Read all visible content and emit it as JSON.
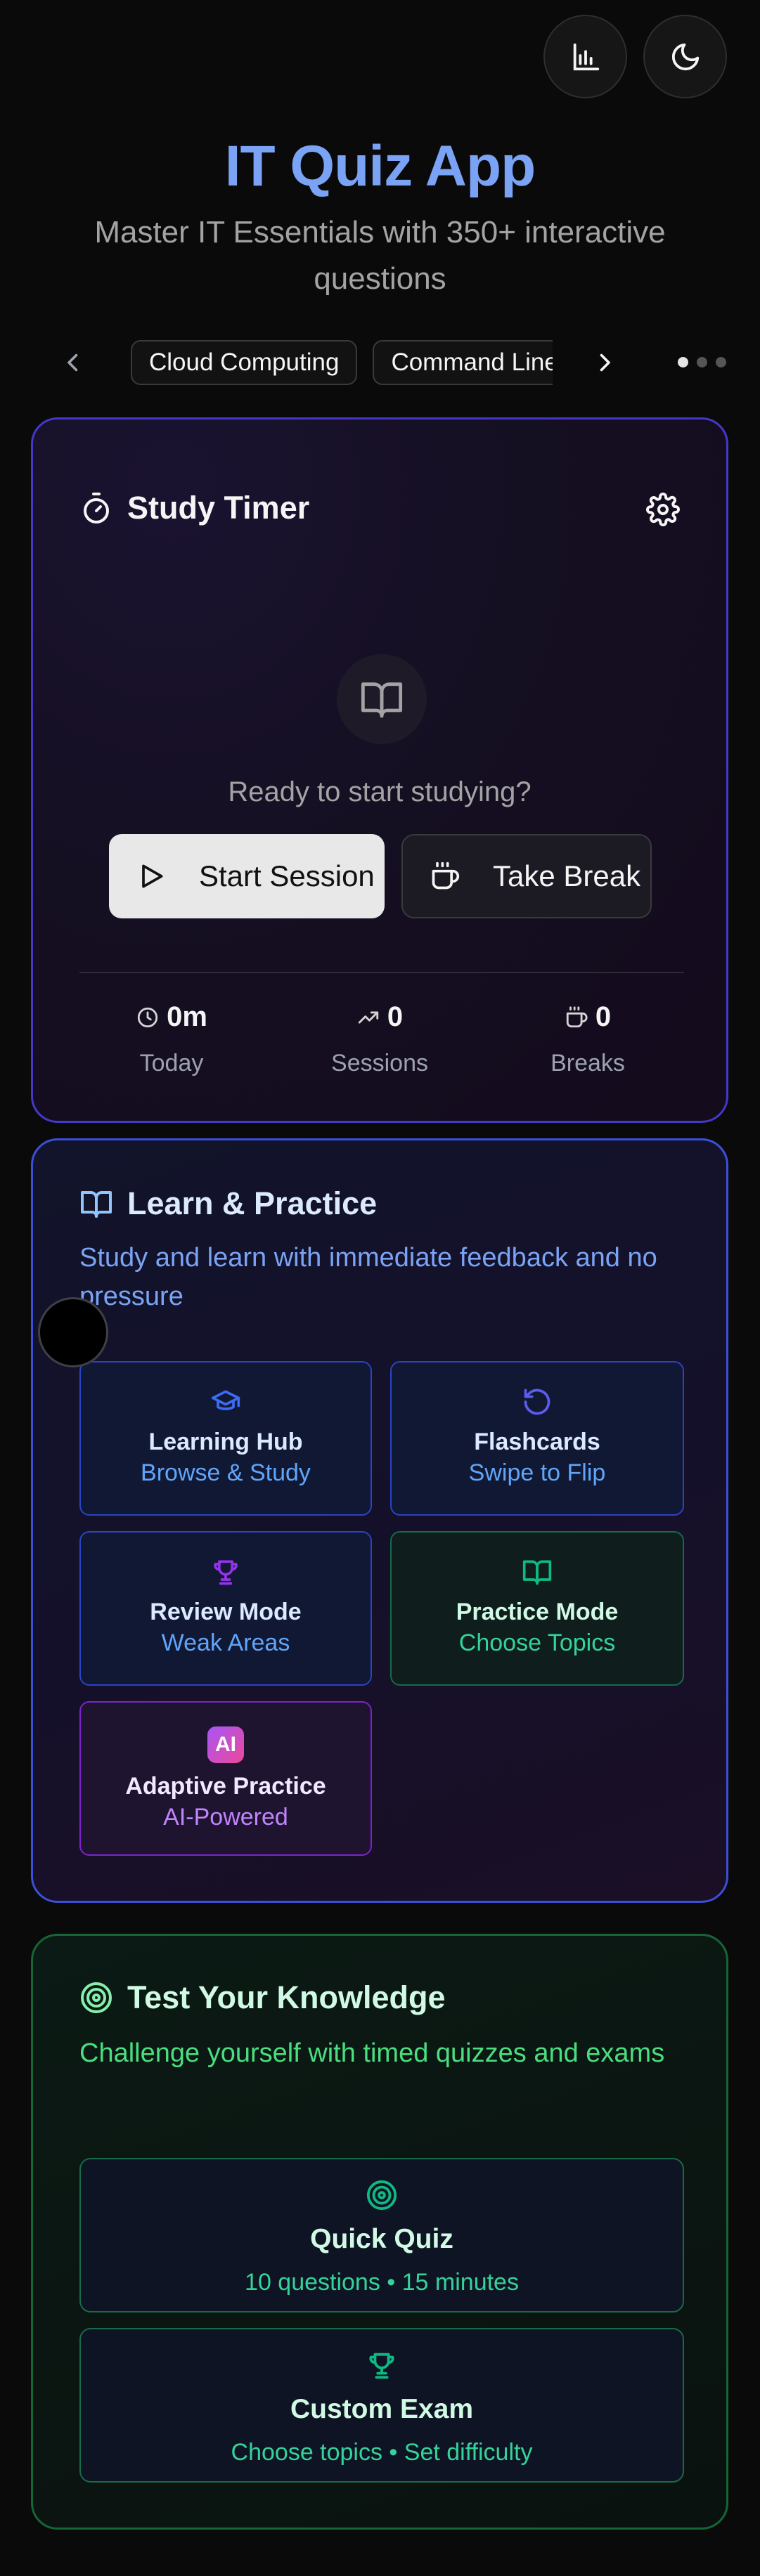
{
  "header": {
    "title": "IT Quiz App",
    "subtitle": "Master IT Essentials with 350+ interactive questions"
  },
  "topics": {
    "chips": [
      "Cloud Computing",
      "Command Line"
    ],
    "page_count": 3,
    "active_page": 1
  },
  "timer": {
    "title": "Study Timer",
    "status": "Ready to start studying?",
    "start_label": "Start Session",
    "break_label": "Take Break",
    "stats": {
      "today_value": "0m",
      "today_label": "Today",
      "sessions_value": "0",
      "sessions_label": "Sessions",
      "breaks_value": "0",
      "breaks_label": "Breaks"
    }
  },
  "learn": {
    "title": "Learn & Practice",
    "description": "Study and learn with immediate feedback and no pressure",
    "tiles": [
      {
        "name": "Learning Hub",
        "sub": "Browse & Study",
        "icon": "graduation-cap-icon"
      },
      {
        "name": "Flashcards",
        "sub": "Swipe to Flip",
        "icon": "rotate-icon"
      },
      {
        "name": "Review Mode",
        "sub": "Weak Areas",
        "icon": "trophy-icon"
      },
      {
        "name": "Practice Mode",
        "sub": "Choose Topics",
        "icon": "book-icon"
      },
      {
        "name": "Adaptive Practice",
        "sub": "AI-Powered",
        "icon": "ai-badge-icon",
        "badge": "AI"
      }
    ]
  },
  "test": {
    "title": "Test Your Knowledge",
    "description": "Challenge yourself with timed quizzes and exams",
    "quick_quiz": {
      "name": "Quick Quiz",
      "sub": "10 questions • 15 minutes"
    },
    "custom_exam": {
      "name": "Custom Exam",
      "sub": "Choose topics • Set difficulty"
    }
  },
  "colors": {
    "accent_blue": "#7ba3f5",
    "link_blue": "#60a5fa",
    "green": "#34d399",
    "purple": "#c084fc"
  }
}
